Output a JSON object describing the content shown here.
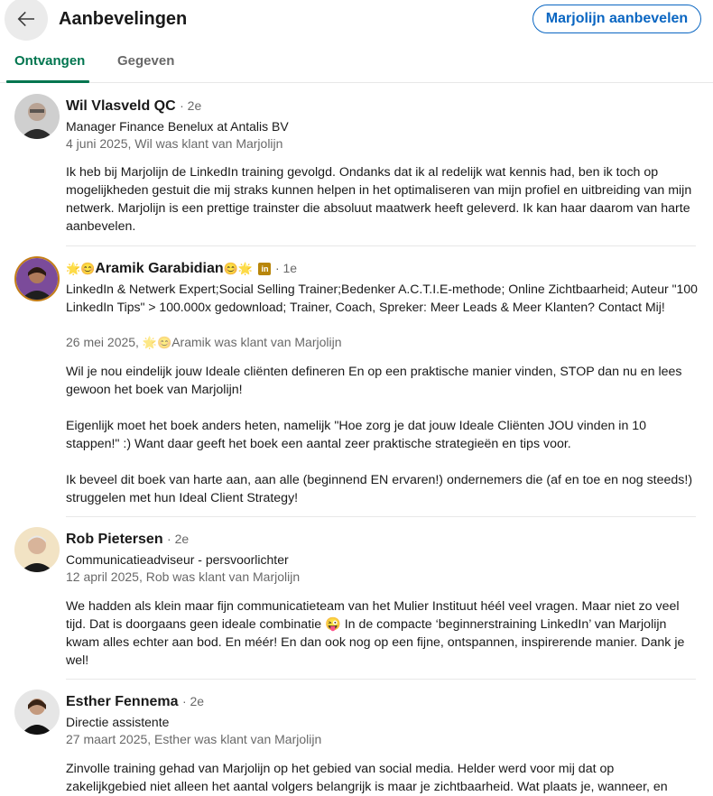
{
  "header": {
    "title": "Aanbevelingen",
    "recommend_button": "Marjolijn aanbevelen"
  },
  "tabs": [
    {
      "label": "Ontvangen",
      "active": true
    },
    {
      "label": "Gegeven",
      "active": false
    }
  ],
  "colors": {
    "accent": "#0a66c2",
    "tab_active": "#01754f"
  },
  "recommendations": [
    {
      "name": "Wil Vlasveld QC",
      "degree": "· 2e",
      "headline": "Manager Finance Benelux at Antalis BV",
      "meta": "4 juni 2025, Wil was klant van Marjolijn",
      "paragraphs": [
        "Ik heb bij Marjolijn de LinkedIn training gevolgd. Ondanks dat ik al redelijk wat kennis had, ben ik toch op mogelijkheden gestuit die mij straks kunnen helpen in het optimaliseren van mijn profiel en uitbreiding van mijn netwerk. Marjolijn is een prettige trainster die absoluut maatwerk heeft geleverd. Ik kan haar daarom van harte aanbevelen."
      ]
    },
    {
      "name": "Aramik Garabidian",
      "name_prefix": "🌟😊",
      "name_suffix": "😊🌟",
      "badge": "in",
      "degree": "· 1e",
      "headline": "LinkedIn & Netwerk Expert;Social Selling Trainer;Bedenker A.C.T.I.E-methode; Online Zichtbaarheid; Auteur \"100 LinkedIn Tips\" > 100.000x gedownload; Trainer, Coach, Spreker: Meer Leads & Meer Klanten? Contact Mij!",
      "meta_prefix": "26 mei 2025, ",
      "meta_emoji": "🌟😊",
      "meta_suffix": "Aramik was klant van Marjolijn",
      "paragraphs": [
        "Wil je nou eindelijk jouw Ideale cliënten defineren En op een praktische manier vinden, STOP dan nu en lees gewoon het boek van Marjolijn!",
        "Eigenlijk moet het boek anders heten, namelijk \"Hoe zorg je dat jouw Ideale Cliënten JOU vinden in 10 stappen!\" :) Want daar geeft het boek een aantal zeer praktische strategieën en tips voor.",
        "Ik beveel dit boek van harte aan, aan alle (beginnend EN ervaren!) ondernemers die (af en toe en nog steeds!) struggelen met hun Ideal Client Strategy!"
      ]
    },
    {
      "name": "Rob Pietersen",
      "degree": "· 2e",
      "headline": "Communicatieadviseur - persvoorlichter",
      "meta": "12 april 2025, Rob was klant van Marjolijn",
      "paragraphs": [
        "We hadden als klein maar fijn communicatieteam van het Mulier Instituut héél veel vragen. Maar niet zo veel tijd. Dat is doorgaans geen ideale combinatie 😜 In de compacte ‘beginnerstraining LinkedIn’ van Marjolijn kwam alles echter aan bod. En méér! En dan ook nog op een fijne, ontspannen, inspirerende manier. Dank je wel!"
      ]
    },
    {
      "name": "Esther Fennema",
      "degree": "· 2e",
      "headline": "Directie assistente",
      "meta": "27 maart 2025, Esther was klant van Marjolijn",
      "paragraphs": [
        "Zinvolle training gehad van Marjolijn op het gebied van social media. Helder werd voor mij dat op zakelijkgebied niet alleen het aantal volgers belangrijk is maar je zichtbaarheid. Wat plaats je, wanneer, en"
      ]
    }
  ]
}
